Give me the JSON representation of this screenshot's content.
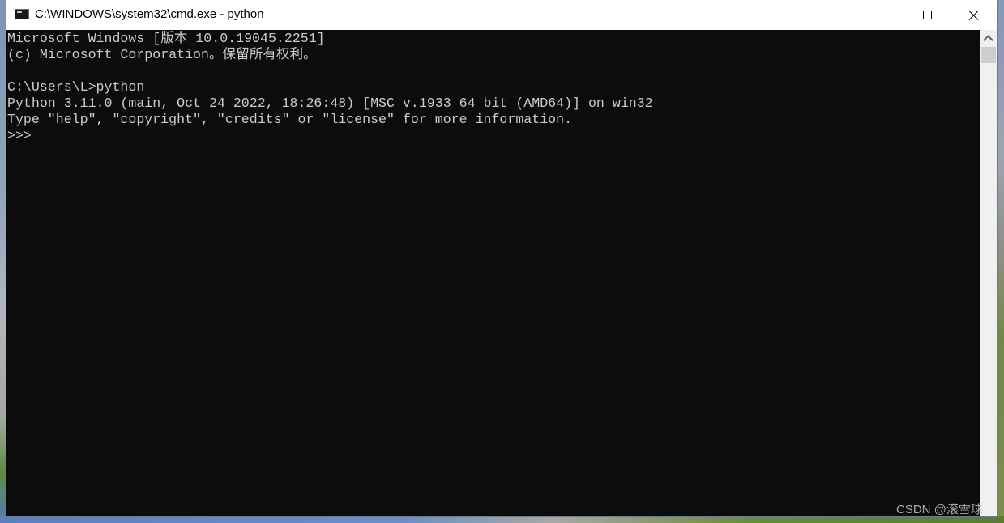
{
  "window": {
    "title": "C:\\WINDOWS\\system32\\cmd.exe - python",
    "icon": "console-icon",
    "controls": {
      "minimize_icon": "minimize-icon",
      "maximize_icon": "maximize-icon",
      "close_icon": "close-icon"
    }
  },
  "console": {
    "background": "#0c0c0c",
    "foreground": "#cccccc",
    "lines": [
      "Microsoft Windows [版本 10.0.19045.2251]",
      "(c) Microsoft Corporation。保留所有权利。",
      "",
      "C:\\Users\\L>python",
      "Python 3.11.0 (main, Oct 24 2022, 18:26:48) [MSC v.1933 64 bit (AMD64)] on win32",
      "Type \"help\", \"copyright\", \"credits\" or \"license\" for more information.",
      ">>>"
    ]
  },
  "scrollbar": {
    "up_arrow_icon": "chevron-up-icon",
    "position_fraction": 0.0
  },
  "watermark": {
    "text": "CSDN @滚雪球"
  }
}
